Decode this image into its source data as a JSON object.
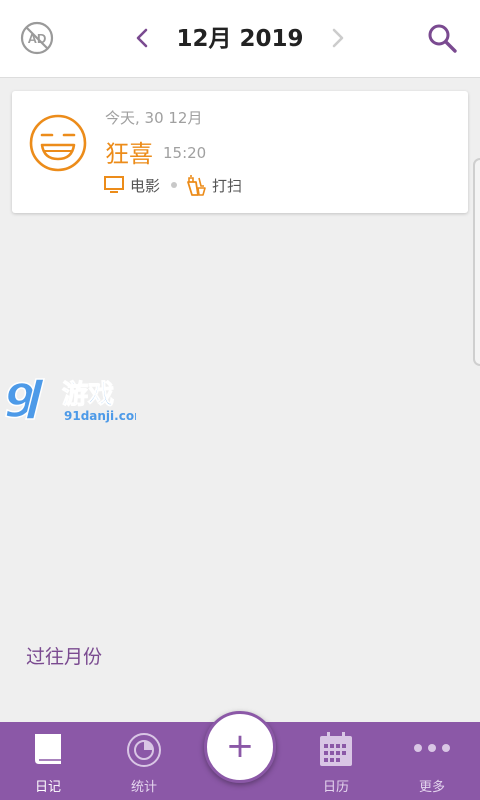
{
  "header": {
    "title": "12月 2019",
    "icons": {
      "left": "no-ads-icon",
      "prev": "chevron-left-icon",
      "next": "chevron-right-icon",
      "right": "search-icon"
    }
  },
  "entries": [
    {
      "date": "今天, 30 12月",
      "mood": "狂喜",
      "time": "15:20",
      "mood_icon": "laughing-face-icon",
      "activities": [
        {
          "label": "电影",
          "icon": "tv-icon"
        },
        {
          "label": "打扫",
          "icon": "cleaning-icon"
        }
      ]
    }
  ],
  "watermark": {
    "number": "9",
    "text": "游戏",
    "domain": "91danji.com"
  },
  "past_months_label": "过往月份",
  "nav": {
    "items": [
      {
        "label": "日记",
        "icon": "book-icon"
      },
      {
        "label": "统计",
        "icon": "stats-disc-icon"
      },
      {
        "label": "日历",
        "icon": "calendar-icon"
      },
      {
        "label": "更多",
        "icon": "more-dots-icon"
      }
    ],
    "add_label": "+"
  },
  "colors": {
    "accent": "#8b58a7",
    "mood": "#ec8c1a",
    "background": "#efefef"
  }
}
